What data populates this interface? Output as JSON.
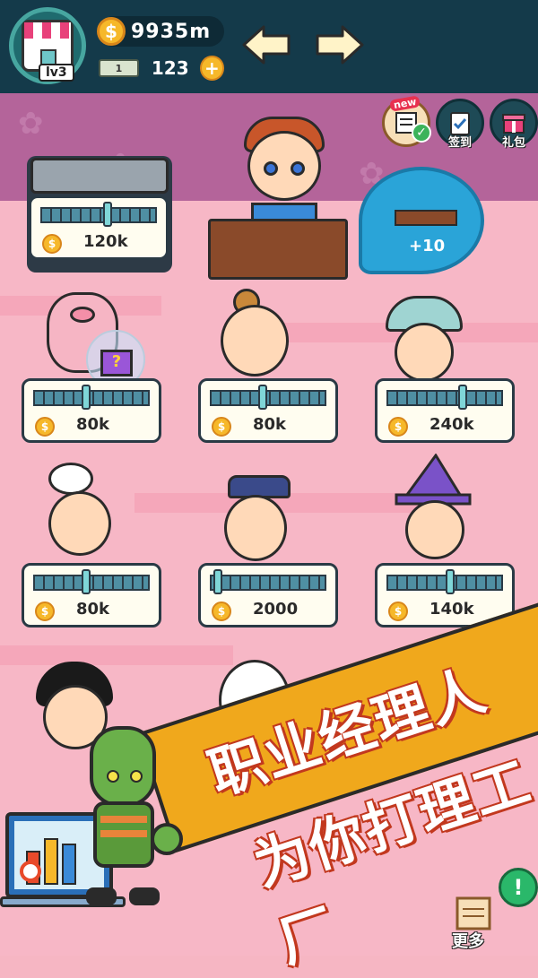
{
  "header": {
    "level_label": "lv3",
    "coins": "9935m",
    "coin_symbol": "$",
    "cash_icon_label": "1",
    "cash": "123",
    "add_cash_symbol": "+"
  },
  "top_icons": {
    "new_tag": "new",
    "checkin_label": "签到",
    "gift_label": "礼包"
  },
  "bubble": {
    "reward": "+10"
  },
  "machine": {
    "price": "120k"
  },
  "workers": [
    {
      "name": "pig-costume-worker",
      "price": "80k"
    },
    {
      "name": "bun-hair-worker",
      "price": "80k"
    },
    {
      "name": "polka-hat-worker",
      "price": "240k"
    },
    {
      "name": "chef-worker",
      "price": "80k"
    },
    {
      "name": "police-worker",
      "price": "2000"
    },
    {
      "name": "witch-worker",
      "price": "140k"
    }
  ],
  "banner": {
    "line1": "职业经理人",
    "line2": "为你打理工厂"
  },
  "bottom": {
    "more_label": "更多",
    "help_symbol": "!"
  },
  "colors": {
    "accent": "#f0a81c",
    "topbar": "#143a4a",
    "wall": "#f7b7c6",
    "coin": "#f6b82a"
  }
}
